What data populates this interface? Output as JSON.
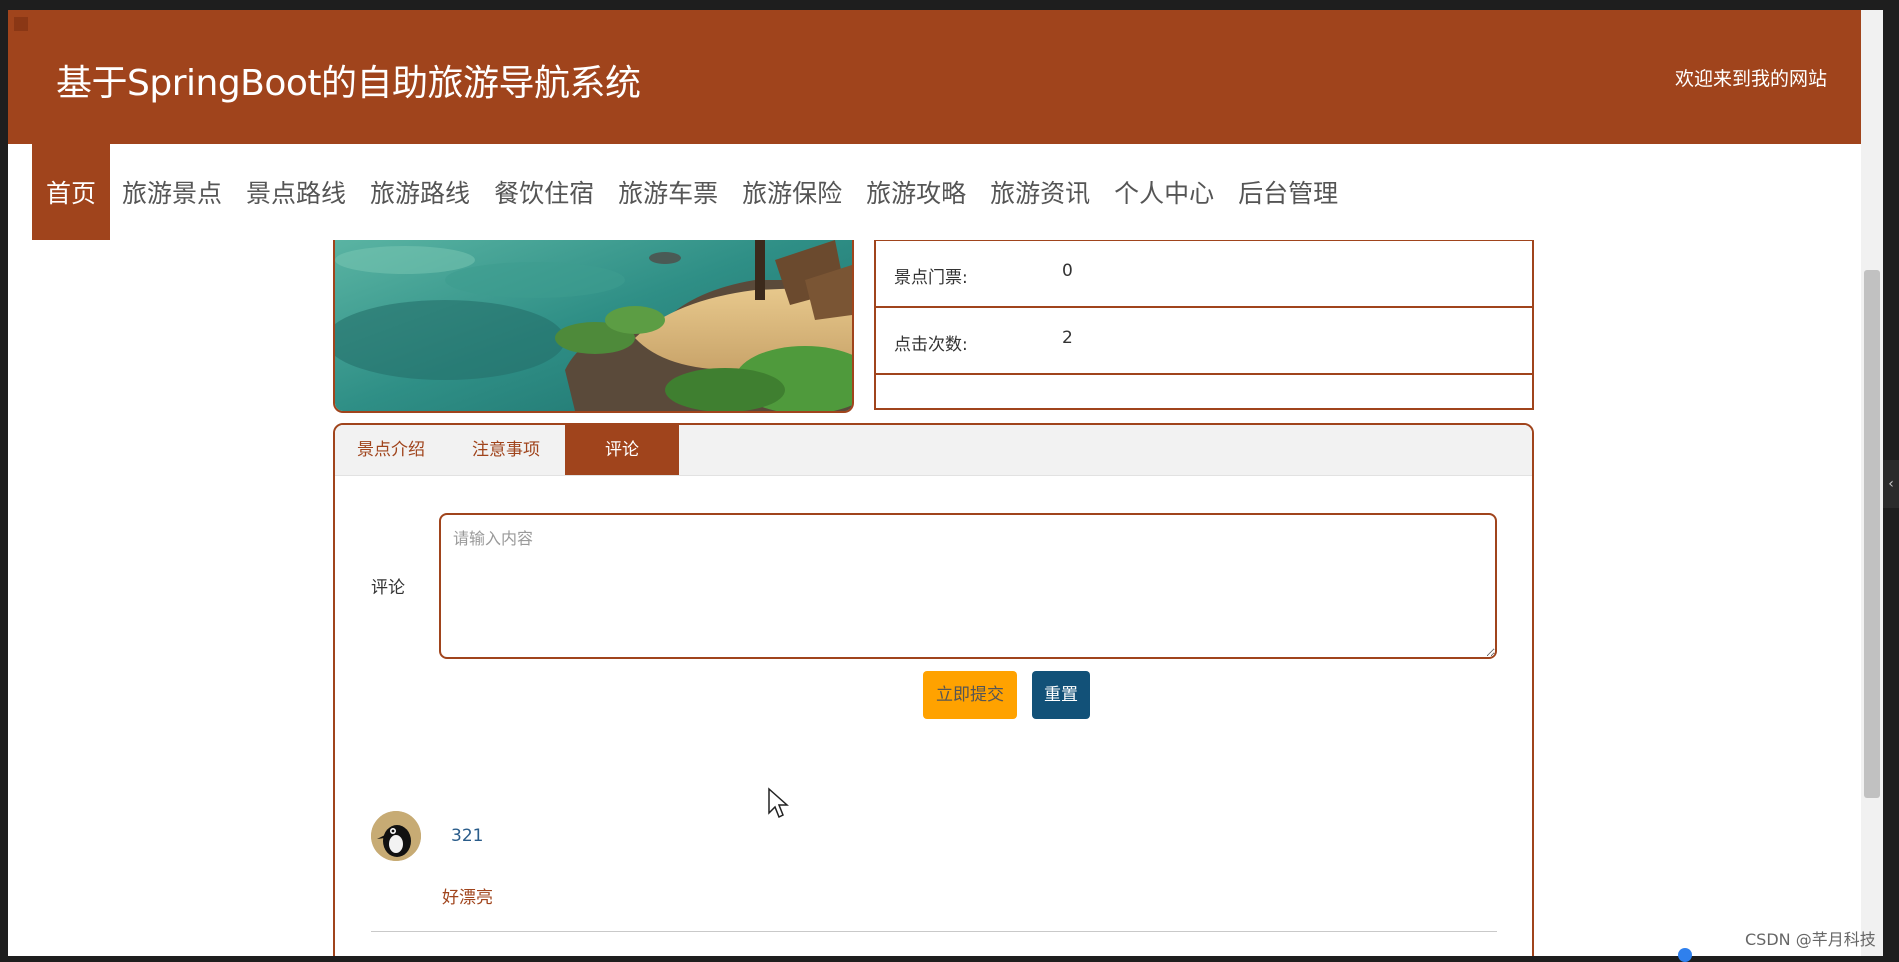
{
  "header": {
    "site_title": "基于SpringBoot的自助旅游导航系统",
    "welcome_text": "欢迎来到我的网站",
    "brand_color": "#a0441c"
  },
  "nav": {
    "items": [
      {
        "label": "首页",
        "active": true
      },
      {
        "label": "旅游景点"
      },
      {
        "label": "景点路线"
      },
      {
        "label": "旅游路线"
      },
      {
        "label": "餐饮住宿"
      },
      {
        "label": "旅游车票"
      },
      {
        "label": "旅游保险"
      },
      {
        "label": "旅游攻略"
      },
      {
        "label": "旅游资讯"
      },
      {
        "label": "个人中心"
      },
      {
        "label": "后台管理"
      }
    ]
  },
  "detail": {
    "rows": [
      {
        "label": "景点门票:",
        "value": "0"
      },
      {
        "label": "点击次数:",
        "value": "2"
      }
    ]
  },
  "tabs": {
    "items": [
      {
        "label": "景点介绍"
      },
      {
        "label": "注意事项"
      },
      {
        "label": "评论",
        "active": true
      }
    ]
  },
  "comment_form": {
    "label": "评论",
    "placeholder": "请输入内容",
    "submit_label": "立即提交",
    "reset_label": "重置",
    "submit_color": "#ffa200",
    "reset_color": "#125178"
  },
  "comments": [
    {
      "user": "321",
      "text": "好漂亮",
      "avatar_icon": "penguin-avatar-icon"
    }
  ],
  "watermark": "CSDN @芊月科技"
}
